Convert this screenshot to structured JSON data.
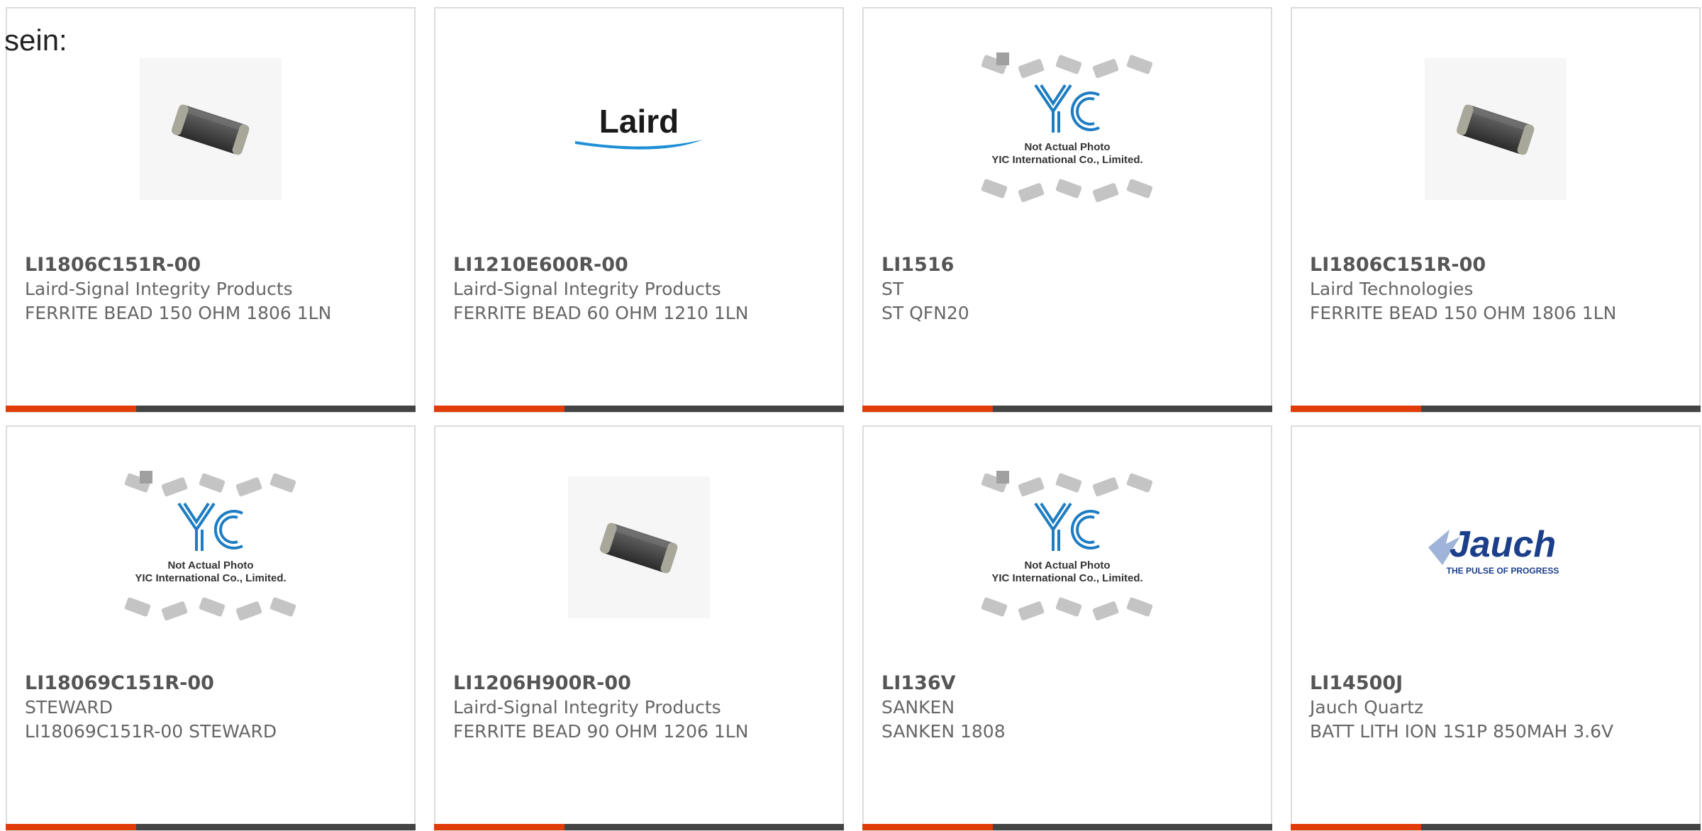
{
  "intro_text": "sein:",
  "colors": {
    "accent": "#e23c06",
    "bar": "#444444",
    "border": "#dcdcdc"
  },
  "cards": [
    {
      "mpn": "LI1806C151R-00",
      "manufacturer": "Laird-Signal Integrity Products",
      "description": "FERRITE BEAD 150 OHM 1806 1LN",
      "image": "ferrite-bead-photo"
    },
    {
      "mpn": "LI1210E600R-00",
      "manufacturer": "Laird-Signal Integrity Products",
      "description": "FERRITE BEAD 60 OHM 1210 1LN",
      "image": "laird-logo",
      "logo_text": "Laird"
    },
    {
      "mpn": "LI1516",
      "manufacturer": "ST",
      "description": "ST QFN20",
      "image": "yic-placeholder",
      "placeholder_line1": "Not Actual Photo",
      "placeholder_line2": "YIC International Co., Limited."
    },
    {
      "mpn": "LI1806C151R-00",
      "manufacturer": "Laird Technologies",
      "description": "FERRITE BEAD 150 OHM 1806 1LN",
      "image": "ferrite-bead-photo"
    },
    {
      "mpn": "LI18069C151R-00",
      "manufacturer": "STEWARD",
      "description": "LI18069C151R-00 STEWARD",
      "image": "yic-placeholder",
      "placeholder_line1": "Not Actual Photo",
      "placeholder_line2": "YIC International Co., Limited."
    },
    {
      "mpn": "LI1206H900R-00",
      "manufacturer": "Laird-Signal Integrity Products",
      "description": "FERRITE BEAD 90 OHM 1206 1LN",
      "image": "ferrite-bead-photo"
    },
    {
      "mpn": "LI136V",
      "manufacturer": "SANKEN",
      "description": "SANKEN 1808",
      "image": "yic-placeholder",
      "placeholder_line1": "Not Actual Photo",
      "placeholder_line2": "YIC International Co., Limited."
    },
    {
      "mpn": "LI14500J",
      "manufacturer": "Jauch Quartz",
      "description": "BATT LITH ION 1S1P 850MAH 3.6V",
      "image": "jauch-logo",
      "logo_text": "Jauch",
      "logo_tagline": "THE PULSE OF PROGRESS"
    }
  ]
}
